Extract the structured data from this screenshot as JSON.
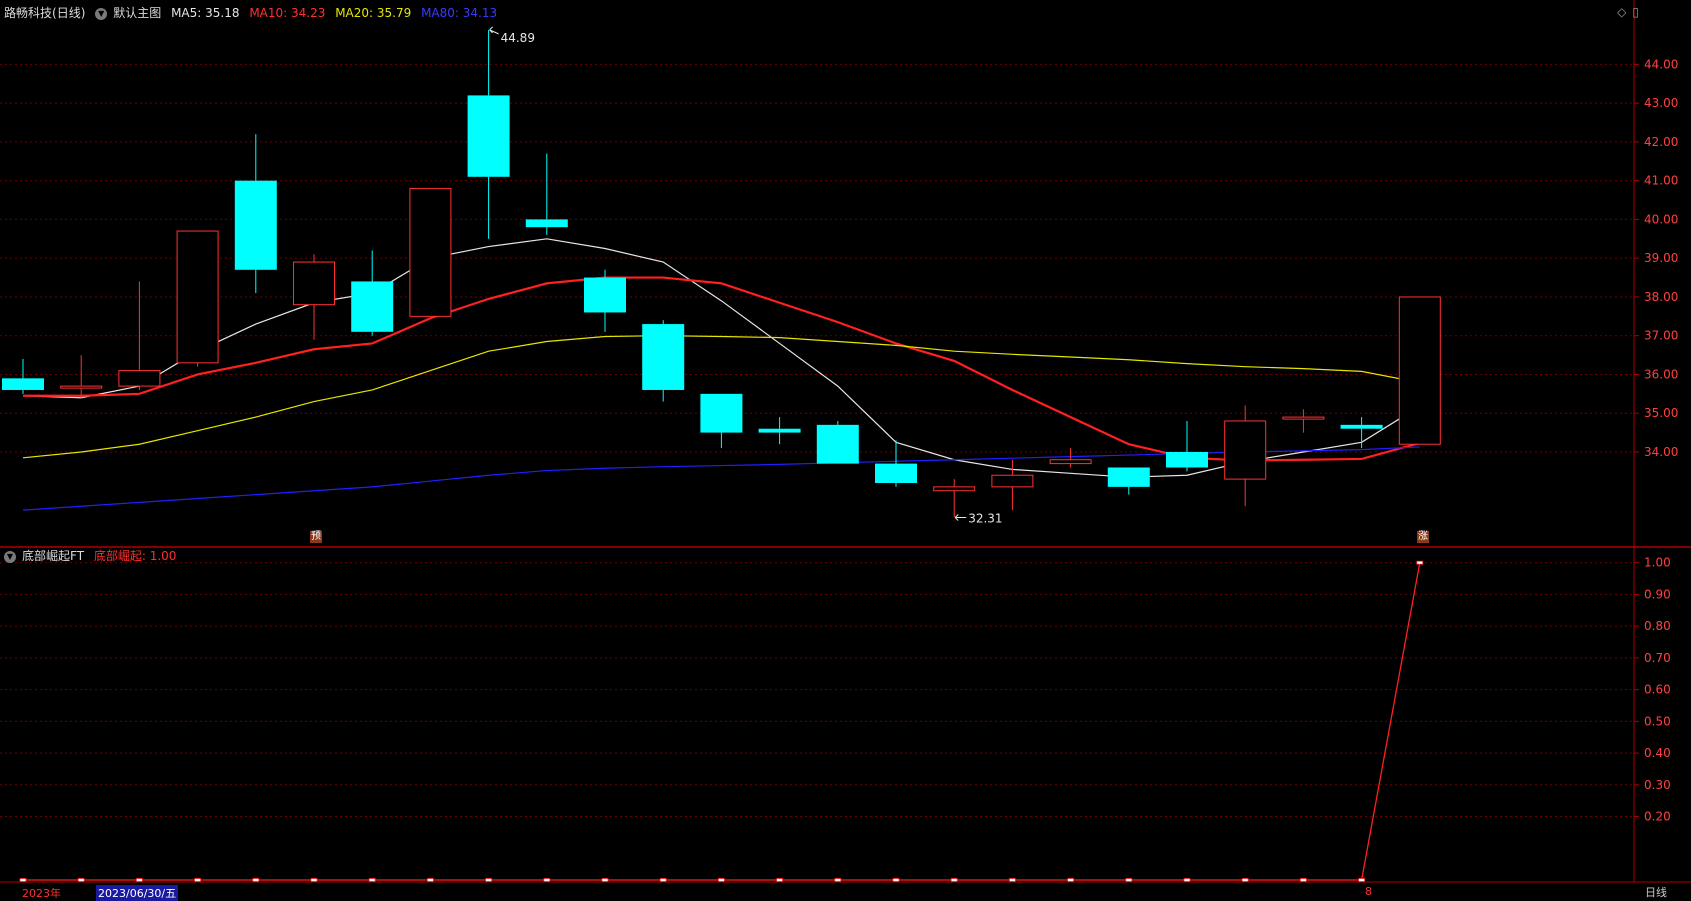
{
  "header": {
    "stock_name": "路畅科技",
    "period": "(日线)",
    "main_chart_name": "默认主图",
    "ma5_label": "MA5: 35.18",
    "ma10_label": "MA10: 34.23",
    "ma20_label": "MA20: 35.79",
    "ma80_label": "MA80: 34.13"
  },
  "indicator_header": {
    "name": "底部崛起FT",
    "value_label": "底部崛起: 1.00"
  },
  "buttons": {
    "diamond_icon": "diamond-icon",
    "window_icon": "restore-icon"
  },
  "annotations": {
    "high": "44.89",
    "low": "32.31",
    "mark_pre": "预",
    "mark_rise": "涨"
  },
  "bottom_bar": {
    "year_label": "2023年",
    "selected_date": "2023/06/30/五",
    "cursor_label": "8",
    "period_label": "日线"
  },
  "colors": {
    "up": "#ff3232",
    "down": "#00ffff",
    "ma5": "#e6e6e6",
    "ma10": "#ff2020",
    "ma20": "#e6e600",
    "ma80": "#2020ff",
    "indicator": "#ff2020",
    "grid": "#700000",
    "axis_text": "#ff4040"
  },
  "chart_data": [
    {
      "type": "candlestick",
      "title": "路畅科技 (日线)",
      "y_ticks": [
        "34.00",
        "35.00",
        "36.00",
        "37.00",
        "38.00",
        "39.00",
        "40.00",
        "41.00",
        "42.00",
        "43.00",
        "44.00"
      ],
      "ylim": [
        31.6,
        45.3
      ],
      "grid": true,
      "candles": [
        {
          "open": 35.9,
          "close": 35.6,
          "high": 36.4,
          "low": 35.5
        },
        {
          "open": 35.7,
          "close": 35.7,
          "high": 36.5,
          "low": 35.4
        },
        {
          "open": 35.7,
          "close": 36.1,
          "high": 38.4,
          "low": 35.6
        },
        {
          "open": 36.3,
          "close": 39.7,
          "high": 39.7,
          "low": 36.2
        },
        {
          "open": 41.0,
          "close": 38.7,
          "high": 42.2,
          "low": 38.1
        },
        {
          "open": 37.8,
          "close": 38.9,
          "high": 39.1,
          "low": 36.9
        },
        {
          "open": 38.4,
          "close": 37.1,
          "high": 39.2,
          "low": 37.0
        },
        {
          "open": 37.5,
          "close": 40.8,
          "high": 40.8,
          "low": 37.5
        },
        {
          "open": 43.2,
          "close": 41.1,
          "high": 44.89,
          "low": 39.5
        },
        {
          "open": 40.0,
          "close": 39.8,
          "high": 41.7,
          "low": 39.6
        },
        {
          "open": 38.5,
          "close": 37.6,
          "high": 38.7,
          "low": 37.1
        },
        {
          "open": 37.3,
          "close": 35.6,
          "high": 37.4,
          "low": 35.3
        },
        {
          "open": 35.5,
          "close": 34.5,
          "high": 35.5,
          "low": 34.1
        },
        {
          "open": 34.6,
          "close": 34.5,
          "high": 34.9,
          "low": 34.2
        },
        {
          "open": 34.7,
          "close": 33.7,
          "high": 34.8,
          "low": 33.7
        },
        {
          "open": 33.7,
          "close": 33.2,
          "high": 34.3,
          "low": 33.1
        },
        {
          "open": 33.0,
          "close": 33.1,
          "high": 33.3,
          "low": 32.31
        },
        {
          "open": 33.1,
          "close": 33.4,
          "high": 33.8,
          "low": 32.5
        },
        {
          "open": 33.7,
          "close": 33.8,
          "high": 34.1,
          "low": 33.6
        },
        {
          "open": 33.6,
          "close": 33.1,
          "high": 33.6,
          "low": 32.9
        },
        {
          "open": 34.0,
          "close": 33.6,
          "high": 34.8,
          "low": 33.5
        },
        {
          "open": 33.3,
          "close": 34.8,
          "high": 35.2,
          "low": 32.6
        },
        {
          "open": 34.9,
          "close": 34.9,
          "high": 35.1,
          "low": 34.5
        },
        {
          "open": 34.7,
          "close": 34.6,
          "high": 34.9,
          "low": 34.1
        },
        {
          "open": 34.2,
          "close": 38.0,
          "high": 38.0,
          "low": 34.2
        }
      ],
      "series": [
        {
          "name": "MA5",
          "values": [
            35.45,
            35.4,
            35.7,
            36.6,
            37.3,
            37.85,
            38.1,
            39.0,
            39.3,
            39.5,
            39.25,
            38.9,
            37.9,
            36.8,
            35.7,
            34.25,
            33.8,
            33.55,
            33.45,
            33.35,
            33.4,
            33.75,
            34.0,
            34.25,
            35.18
          ]
        },
        {
          "name": "MA10",
          "values": [
            35.45,
            35.45,
            35.5,
            36.0,
            36.3,
            36.65,
            36.8,
            37.45,
            37.95,
            38.35,
            38.5,
            38.5,
            38.35,
            37.85,
            37.35,
            36.8,
            36.35,
            35.6,
            34.9,
            34.2,
            33.85,
            33.78,
            33.8,
            33.82,
            34.23
          ]
        },
        {
          "name": "MA20",
          "values": [
            33.85,
            34.0,
            34.2,
            34.55,
            34.9,
            35.3,
            35.6,
            36.1,
            36.6,
            36.85,
            36.98,
            37.0,
            36.98,
            36.95,
            36.85,
            36.75,
            36.6,
            36.52,
            36.45,
            36.38,
            36.28,
            36.2,
            36.15,
            36.08,
            35.79
          ]
        },
        {
          "name": "MA80",
          "values": [
            32.5,
            32.6,
            32.7,
            32.8,
            32.9,
            33.0,
            33.1,
            33.25,
            33.4,
            33.52,
            33.58,
            33.62,
            33.65,
            33.68,
            33.72,
            33.76,
            33.8,
            33.84,
            33.88,
            33.92,
            33.96,
            34.0,
            34.03,
            34.06,
            34.13
          ]
        }
      ]
    },
    {
      "type": "line",
      "title": "底部崛起FT",
      "y_ticks": [
        "0.20",
        "0.30",
        "0.40",
        "0.50",
        "0.60",
        "0.70",
        "0.80",
        "0.90",
        "1.00"
      ],
      "ylim": [
        0,
        1.04
      ],
      "grid": true,
      "series": [
        {
          "name": "底部崛起",
          "values": [
            0,
            0,
            0,
            0,
            0,
            0,
            0,
            0,
            0,
            0,
            0,
            0,
            0,
            0,
            0,
            0,
            0,
            0,
            0,
            0,
            0,
            0,
            0,
            0,
            1.0
          ]
        }
      ]
    }
  ]
}
